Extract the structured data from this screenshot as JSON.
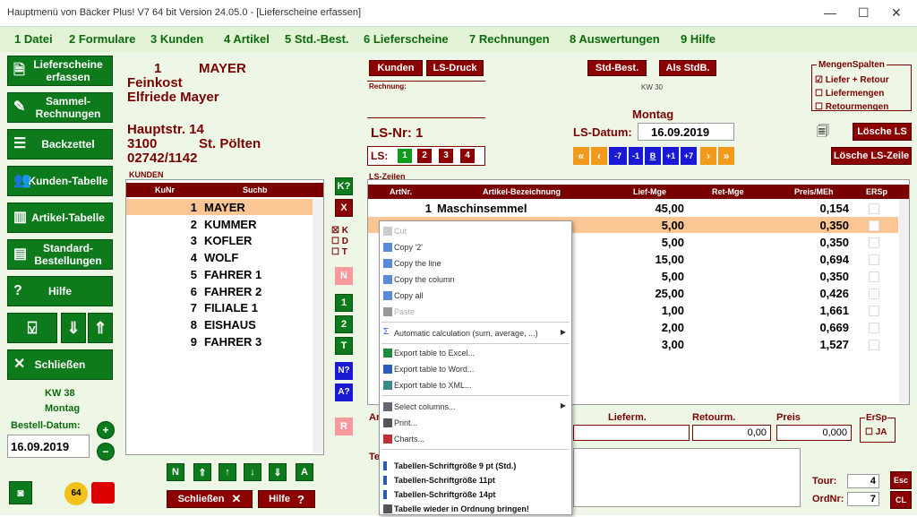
{
  "title": "Hauptmenü von Bäcker Plus! V7 64 bit Version 24.05.0 - [Lieferscheine erfassen]",
  "menu": [
    "1 Datei",
    "2 Formulare",
    "3 Kunden",
    "4 Artikel",
    "5 Std.-Best.",
    "6 Lieferscheine",
    "7 Rechnungen",
    "8 Auswertungen",
    "9 Hilfe"
  ],
  "side": {
    "lieferscheine": "Lieferscheine erfassen",
    "sammel": "Sammel-Rechnungen",
    "backzettel": "Backzettel",
    "kunden": "Kunden-Tabelle",
    "artikel": "Artikel-Tabelle",
    "standard": "Standard-Bestellungen",
    "hilfe": "Hilfe",
    "schliessen": "Schließen",
    "kw": "KW 38",
    "day": "Montag",
    "bestell_label": "Bestell-Datum:",
    "bestell_date": "16.09.2019"
  },
  "customer": {
    "nr": "1",
    "name": "MAYER",
    "line1": "Feinkost",
    "line2": "Elfriede Mayer",
    "street": "Hauptstr. 14",
    "plz": "3100",
    "city": "St. Pölten",
    "phone": "02742/1142"
  },
  "kunden": {
    "title": "KUNDEN",
    "col1": "KuNr",
    "col2": "Suchb",
    "rows": [
      {
        "nr": "1",
        "name": "MAYER"
      },
      {
        "nr": "2",
        "name": "KUMMER"
      },
      {
        "nr": "3",
        "name": "KOFLER"
      },
      {
        "nr": "4",
        "name": "WOLF"
      },
      {
        "nr": "5",
        "name": "FAHRER 1"
      },
      {
        "nr": "6",
        "name": "FAHRER 2"
      },
      {
        "nr": "7",
        "name": "FILIALE 1"
      },
      {
        "nr": "8",
        "name": "EISHAUS"
      },
      {
        "nr": "9",
        "name": "FAHRER 3"
      }
    ]
  },
  "mid": {
    "k": "K?",
    "x": "X",
    "kdt": [
      "K",
      "D",
      "T"
    ],
    "n": "N",
    "b1": "1",
    "b2": "2",
    "t": "T",
    "nq": "N?",
    "aq": "A?",
    "r": "R"
  },
  "bottom": {
    "n": "N",
    "a": "A",
    "schliessen": "Schließen",
    "hilfe": "Hilfe"
  },
  "top": {
    "kunden": "Kunden",
    "lsdruck": "LS-Druck",
    "stdbest": "Std-Best.",
    "alsstdb": "Als StdB.",
    "rechnung": "Rechnung:",
    "kw30": "KW 30",
    "montag": "Montag",
    "lsnr": "LS-Nr: 1",
    "lsdatum_lbl": "LS-Datum:",
    "lsdatum": "16.09.2019",
    "ls": "LS:",
    "ls_tabs": [
      "1",
      "2",
      "3",
      "4"
    ],
    "nav": [
      "-7",
      "-1",
      "B",
      "+1",
      "+7"
    ]
  },
  "mengen": {
    "title": "MengenSpalten",
    "opts": [
      "Liefer + Retour",
      "Liefermengen",
      "Retourmengen"
    ]
  },
  "loesche": {
    "ls": "Lösche LS",
    "zeile": "Lösche LS-Zeile"
  },
  "table": {
    "title": "LS-Zeilen",
    "cols": [
      "ArtNr.",
      "Artikel-Bezeichnung",
      "Lief-Mge",
      "Ret-Mge",
      "Preis/MEh",
      "ERSp"
    ],
    "rows": [
      {
        "nr": "1",
        "name": "Maschinsemmel",
        "lief": "45,00",
        "preis": "0,154"
      },
      {
        "nr": "",
        "name": "",
        "lief": "5,00",
        "preis": "0,350"
      },
      {
        "nr": "",
        "name": "",
        "lief": "5,00",
        "preis": "0,350"
      },
      {
        "nr": "",
        "name": "",
        "lief": "15,00",
        "preis": "0,694"
      },
      {
        "nr": "",
        "name": "",
        "lief": "5,00",
        "preis": "0,350"
      },
      {
        "nr": "",
        "name": "",
        "lief": "25,00",
        "preis": "0,426"
      },
      {
        "nr": "",
        "name": "",
        "lief": "1,00",
        "preis": "1,661"
      },
      {
        "nr": "",
        "name": "",
        "lief": "2,00",
        "preis": "0,669"
      },
      {
        "nr": "",
        "name": "",
        "lief": "3,00",
        "preis": "1,527"
      }
    ]
  },
  "form": {
    "ar": "Ar",
    "te": "Te",
    "lieferm": "Lieferm.",
    "retourm": "Retourm.",
    "preis": "Preis",
    "v1": "0,00",
    "v2": "0,00",
    "v3": "0,000",
    "ersp": "ErSp",
    "ja": "JA",
    "tour_lbl": "Tour:",
    "tour": "4",
    "ordnr_lbl": "OrdNr:",
    "ordnr": "7",
    "esc": "Esc",
    "cl": "CL"
  },
  "context": {
    "cut": "Cut",
    "copy2": "Copy '2'",
    "copyline": "Copy the line",
    "copycol": "Copy the column",
    "copyall": "Copy all",
    "paste": "Paste",
    "auto": "Automatic calculation (sum, average, ...)",
    "excel": "Export table to Excel...",
    "word": "Export table to Word...",
    "xml": "Export table to XML...",
    "selcol": "Select columns...",
    "print": "Print...",
    "charts": "Charts...",
    "f9": "Tabellen-Schriftgröße 9 pt (Std.)",
    "f11": "Tabellen-Schriftgröße 11pt",
    "f14": "Tabellen-Schriftgröße 14pt",
    "reset": "Tabelle wieder in Ordnung bringen!"
  }
}
